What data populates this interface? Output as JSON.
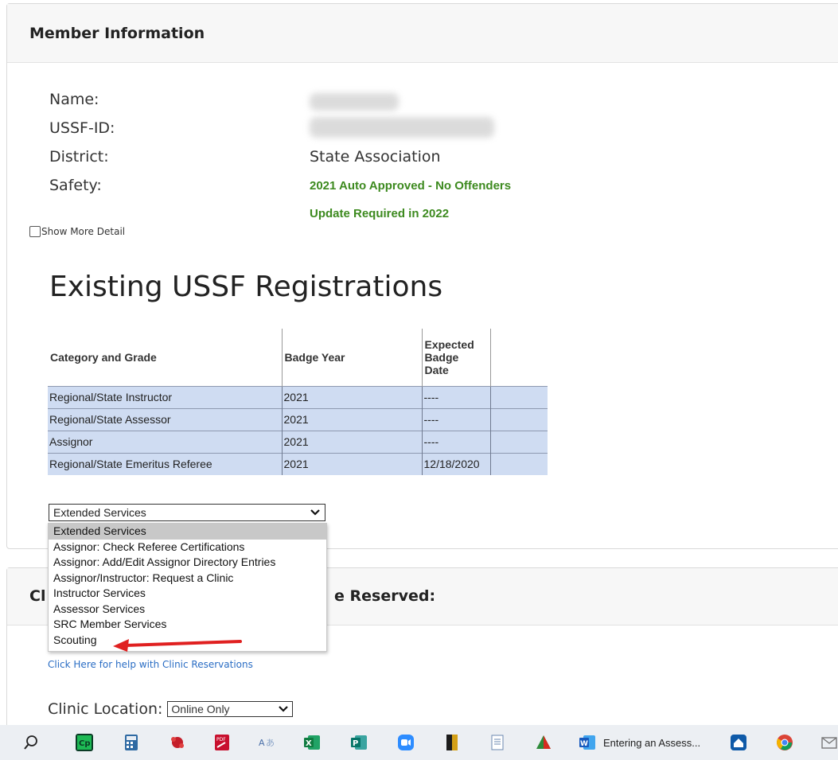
{
  "member_card": {
    "title": "Member Information",
    "fields": [
      {
        "label": "Name:",
        "value": ""
      },
      {
        "label": "USSF-ID:",
        "value": ""
      },
      {
        "label": "District:",
        "value": "State Association"
      },
      {
        "label": "Safety:",
        "value": "2021 Auto Approved - No Offenders"
      }
    ],
    "safety_note": "Update Required in 2022",
    "show_more_label": "Show More Detail"
  },
  "registrations": {
    "title": "Existing USSF Registrations",
    "headers": [
      "Category and Grade",
      "Badge Year",
      "Expected Badge Date",
      ""
    ],
    "rows": [
      [
        "Regional/State Instructor",
        "2021",
        "----",
        ""
      ],
      [
        "Regional/State Assessor",
        "2021",
        "----",
        ""
      ],
      [
        "Assignor",
        "2021",
        "----",
        ""
      ],
      [
        "Regional/State Emeritus Referee",
        "2021",
        "12/18/2020",
        ""
      ]
    ]
  },
  "services_select": {
    "selected": "Extended Services",
    "options": [
      "Extended Services",
      "Assignor: Check Referee Certifications",
      "Assignor: Add/Edit Assignor Directory Entries",
      "Assignor/Instructor: Request a Clinic",
      "Instructor Services",
      "Assessor Services",
      "SRC Member Services",
      "Scouting"
    ]
  },
  "clinic_card": {
    "title_left": "Cl",
    "title_right": "e Reserved:",
    "help_link": "Click Here for help with Clinic Reservations",
    "location_label": "Clinic Location:",
    "location_value": "Online Only"
  },
  "taskbar": {
    "task_label": "Entering an Assess...",
    "icons": [
      "search-icon",
      "captivate-icon",
      "calculator-icon",
      "app-icon",
      "pdf-icon",
      "translate-icon",
      "excel-icon",
      "publisher-icon",
      "zoom-icon",
      "book-icon",
      "notepad-icon",
      "app2-icon",
      "word-icon",
      "outlook-icon",
      "chrome-icon",
      "mail-icon"
    ]
  },
  "colors": {
    "safety_green": "#3d8a1f",
    "table_row_bg": "#cfdcf2",
    "link_blue": "#2a6dc4",
    "annotation_red": "#e02020"
  }
}
